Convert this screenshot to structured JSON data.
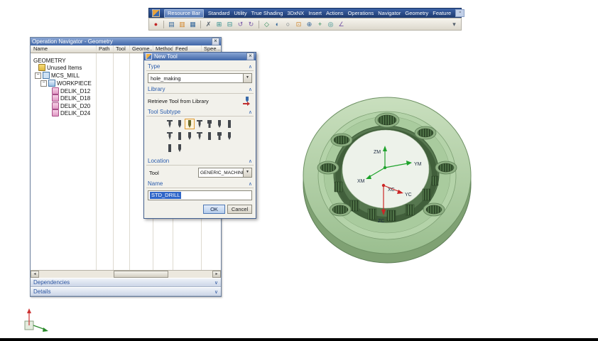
{
  "toolbar": {
    "title": "Resource Bar",
    "menus": [
      "Standard",
      "Utility",
      "True Shading",
      "3DxNX",
      "Insert",
      "Actions",
      "Operations",
      "Navigator",
      "Geometry",
      "Feature"
    ],
    "window_button_glyph": "▫",
    "icons": [
      {
        "name": "record-icon",
        "glyph": "●"
      },
      {
        "name": "new-icon",
        "glyph": "▤"
      },
      {
        "name": "open-icon",
        "glyph": "▥"
      },
      {
        "name": "save-icon",
        "glyph": "▦"
      },
      {
        "name": "cut-icon",
        "glyph": "✗"
      },
      {
        "name": "copy-icon",
        "glyph": "⊞"
      },
      {
        "name": "paste-icon",
        "glyph": "⊟"
      },
      {
        "name": "undo-icon",
        "glyph": "↺"
      },
      {
        "name": "redo-icon",
        "glyph": "↻"
      },
      {
        "name": "orient-view-icon",
        "glyph": "◇"
      },
      {
        "name": "shaded-view-icon",
        "glyph": "◐"
      },
      {
        "name": "wireframe-view-icon",
        "glyph": "○"
      },
      {
        "name": "fit-view-icon",
        "glyph": "⊡"
      },
      {
        "name": "zoom-icon",
        "glyph": "⊕"
      },
      {
        "name": "pan-icon",
        "glyph": "+"
      },
      {
        "name": "rotate-icon",
        "glyph": "◎"
      },
      {
        "name": "measure-icon",
        "glyph": "∠"
      },
      {
        "name": "more-tools-icon",
        "glyph": "▾"
      }
    ]
  },
  "navigator": {
    "title": "Operation Navigator - Geometry",
    "close_glyph": "×",
    "columns": [
      "Name",
      "Path",
      "Tool",
      "Geome...",
      "Method",
      "Feed",
      "Spee..."
    ],
    "tree": [
      {
        "label": "GEOMETRY",
        "icon": "none"
      },
      {
        "label": "Unused Items",
        "icon": "folder"
      },
      {
        "label": "MCS_MILL",
        "icon": "mcs",
        "expander": "−"
      },
      {
        "label": "WORKPIECE",
        "icon": "workpiece",
        "expander": "−"
      },
      {
        "label": "DELIK_D12",
        "icon": "hole-geometry"
      },
      {
        "label": "DELIK_D18",
        "icon": "hole-geometry"
      },
      {
        "label": "DELIK_D20",
        "icon": "hole-geometry"
      },
      {
        "label": "DELIK_D24",
        "icon": "hole-geometry"
      }
    ],
    "scrollbar": {
      "left_glyph": "◂",
      "right_glyph": "▸"
    },
    "sections": [
      {
        "label": "Dependencies",
        "chevron": "∨"
      },
      {
        "label": "Details",
        "chevron": "∨"
      }
    ]
  },
  "dialog": {
    "title": "New Tool",
    "close_glyph": "×",
    "chevron_expanded": "∧",
    "dropdown_glyph": "▼",
    "type": {
      "label": "Type",
      "value": "hole_making"
    },
    "library": {
      "label": "Library",
      "retrieve": "Retrieve Tool from Library"
    },
    "subtype": {
      "label": "Tool Subtype",
      "selected_index": 2,
      "count": 16
    },
    "location": {
      "label": "Location",
      "tool_label": "Tool",
      "tool_value": "GENERIC_MACHINE"
    },
    "name": {
      "label": "Name",
      "value": "STD_DRILL"
    },
    "buttons": {
      "ok": "OK",
      "cancel": "Cancel"
    }
  },
  "viewport": {
    "part_color": "#b4d3a9",
    "csys": {
      "zm": "ZM",
      "ym": "YM",
      "xm": "XM",
      "xc": "XC",
      "yc": "YC",
      "zc": "ZC"
    }
  }
}
